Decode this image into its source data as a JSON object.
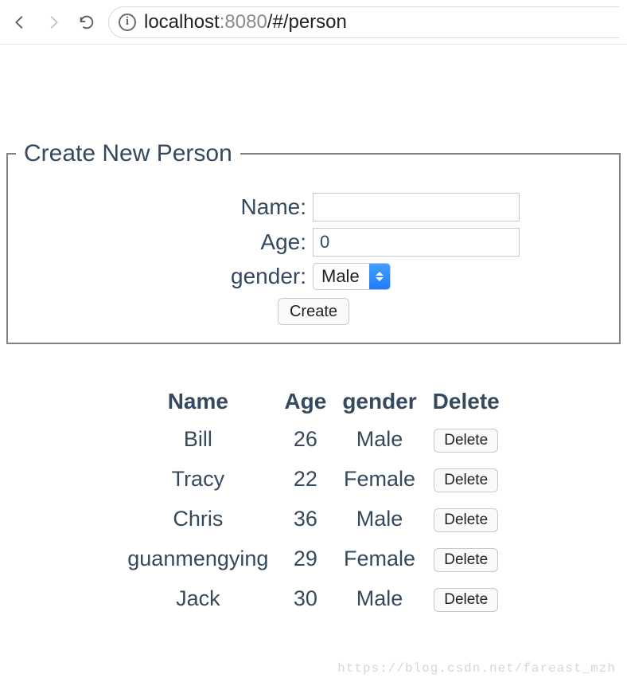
{
  "browser": {
    "url_host": "localhost",
    "url_port": ":8080",
    "url_path": "/#/person"
  },
  "form": {
    "legend": "Create New Person",
    "name_label": "Name:",
    "name_value": "",
    "age_label": "Age:",
    "age_value": "0",
    "gender_label": "gender:",
    "gender_value": "Male",
    "create_label": "Create"
  },
  "table": {
    "headers": {
      "name": "Name",
      "age": "Age",
      "gender": "gender",
      "delete": "Delete"
    },
    "delete_label": "Delete",
    "rows": [
      {
        "name": "Bill",
        "age": "26",
        "gender": "Male"
      },
      {
        "name": "Tracy",
        "age": "22",
        "gender": "Female"
      },
      {
        "name": "Chris",
        "age": "36",
        "gender": "Male"
      },
      {
        "name": "guanmengying",
        "age": "29",
        "gender": "Female"
      },
      {
        "name": "Jack",
        "age": "30",
        "gender": "Male"
      }
    ]
  },
  "watermark": "https://blog.csdn.net/fareast_mzh"
}
